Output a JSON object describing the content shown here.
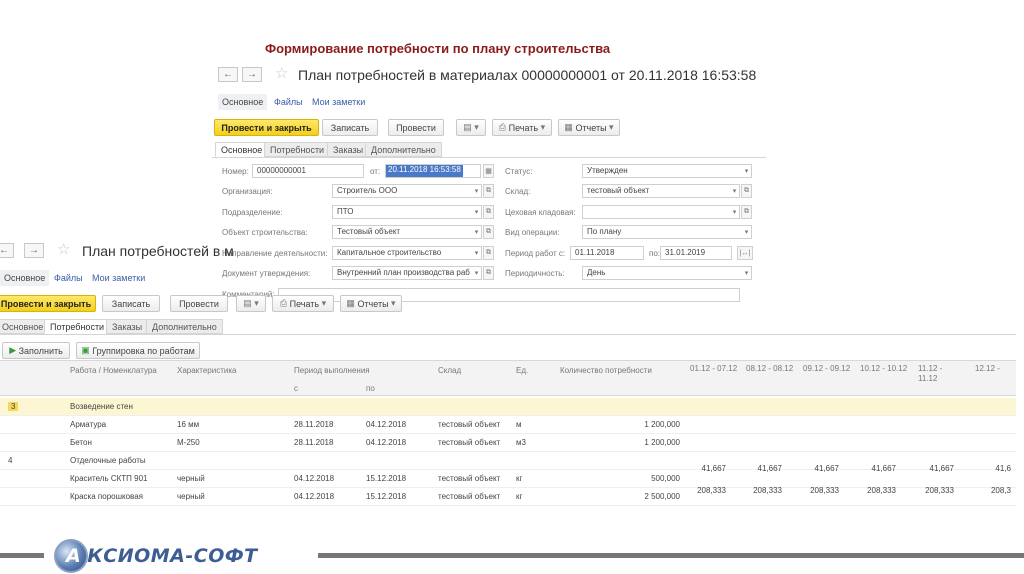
{
  "slide": {
    "title": "Формирование потребности по плану строительства",
    "logo_text": "КСИОМА-СОФТ",
    "logo_letter": "А"
  },
  "form1": {
    "title": "План потребностей в материалах 00000000001 от 20.11.2018 16:53:58",
    "nav": {
      "back": "←",
      "forward": "→",
      "star": "☆"
    },
    "links": [
      "Основное",
      "Файлы",
      "Мои заметки"
    ],
    "toolbar": {
      "post_close": "Провести и закрыть",
      "save": "Записать",
      "post": "Провести",
      "print": "Печать",
      "reports": "Отчеты"
    },
    "tabs": [
      "Основное",
      "Потребности",
      "Заказы",
      "Дополнительно"
    ],
    "left_fields": [
      {
        "label": "Номер:",
        "value": "00000000001"
      },
      {
        "label": "Организация:",
        "value": "Строитель ООО"
      },
      {
        "label": "Подразделение:",
        "value": "ПТО"
      },
      {
        "label": "Объект строительства:",
        "value": "Тестовый объект"
      },
      {
        "label": "Направление деятельности:",
        "value": "Капитальное строительство"
      },
      {
        "label": "Документ утверждения:",
        "value": "Внутренний план производства раб"
      },
      {
        "label": "Комментарий:",
        "value": ""
      }
    ],
    "date_label": "от:",
    "date_value": "20.11.2018 16:53:58",
    "right_fields": [
      {
        "label": "Статус:",
        "value": "Утвержден"
      },
      {
        "label": "Склад:",
        "value": "тестовый объект"
      },
      {
        "label": "Цеховая кладовая:",
        "value": ""
      },
      {
        "label": "Вид операции:",
        "value": "По плану"
      },
      {
        "label": "Период работ с:",
        "value": "01.11.2018"
      },
      {
        "label": "Периодичность:",
        "value": "День"
      }
    ],
    "period_to_label": "по:",
    "period_to_value": "31.01.2019"
  },
  "form2": {
    "title": "План потребностей в м",
    "nav": {
      "back": "←",
      "forward": "→",
      "star": "☆"
    },
    "links": [
      "Основное",
      "Файлы",
      "Мои заметки"
    ],
    "toolbar": {
      "post_close": "Провести и закрыть",
      "save": "Записать",
      "post": "Провести",
      "print": "Печать",
      "reports": "Отчеты"
    },
    "tabs": [
      "Основное",
      "Потребности",
      "Заказы",
      "Дополнительно"
    ],
    "grid_toolbar": {
      "fill": "Заполнить",
      "group": "Группировка по работам"
    },
    "columns": {
      "work": "Работа / Номенклатура",
      "characteristic": "Характеристика",
      "period": "Период выполнения",
      "from": "с",
      "to": "по",
      "warehouse": "Склад",
      "unit": "Ед.",
      "quantity": "Количество потребности",
      "periods": [
        "01.12 - 07.12",
        "08.12 - 08.12",
        "09.12 - 09.12",
        "10.12 - 10.12",
        "11.12 - 11.12",
        "12.12 -"
      ]
    },
    "rows": [
      {
        "num": "3",
        "name": "Возведение стен",
        "char": "",
        "from": "",
        "to": "",
        "wh": "",
        "unit": "",
        "qty": "",
        "vals": []
      },
      {
        "num": "",
        "name": "Арматура",
        "char": "16 мм",
        "from": "28.11.2018",
        "to": "04.12.2018",
        "wh": "тестовый объект",
        "unit": "м",
        "qty": "1 200,000",
        "vals": []
      },
      {
        "num": "",
        "name": "Бетон",
        "char": "М-250",
        "from": "28.11.2018",
        "to": "04.12.2018",
        "wh": "тестовый объект",
        "unit": "м3",
        "qty": "1 200,000",
        "vals": []
      },
      {
        "num": "4",
        "name": "Отделочные работы",
        "char": "",
        "from": "",
        "to": "",
        "wh": "",
        "unit": "",
        "qty": "",
        "vals": []
      },
      {
        "num": "",
        "name": "Краситель СКТП 901",
        "char": "черный",
        "from": "04.12.2018",
        "to": "15.12.2018",
        "wh": "тестовый объект",
        "unit": "кг",
        "qty": "500,000",
        "vals": [
          "41,667",
          "41,667",
          "41,667",
          "41,667",
          "41,667",
          "41,6"
        ]
      },
      {
        "num": "",
        "name": "Краска порошковая",
        "char": "черный",
        "from": "04.12.2018",
        "to": "15.12.2018",
        "wh": "тестовый объект",
        "unit": "кг",
        "qty": "2 500,000",
        "vals": [
          "208,333",
          "208,333",
          "208,333",
          "208,333",
          "208,333",
          "208,3"
        ]
      }
    ]
  }
}
